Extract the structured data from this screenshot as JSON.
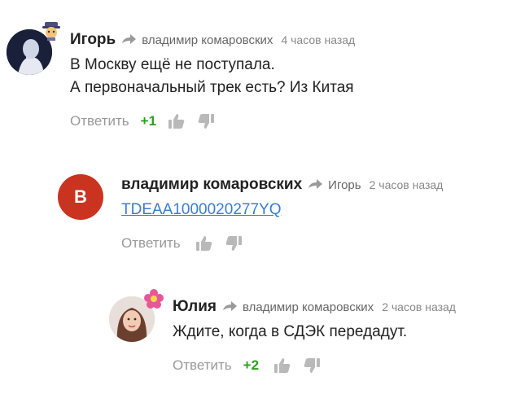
{
  "comments": [
    {
      "author": "Игорь",
      "reply_to": "владимир комаровских",
      "time": "4 часов назад",
      "text_lines": [
        "В Москву ещё не поступала.",
        "А первоначальный трек есть? Из Китая"
      ],
      "reply_label": "Ответить",
      "score": "+1",
      "avatar_icon": "hooded-figure-avatar",
      "badge_icon": "detective-emoji-badge"
    },
    {
      "author": "владимир комаровских",
      "reply_to": "Игорь",
      "time": "2 часов назад",
      "link_text": "TDEAA1000020277YQ",
      "reply_label": "Ответить",
      "score": "",
      "avatar_letter": "В",
      "avatar_color": "#c9331f"
    },
    {
      "author": "Юлия",
      "reply_to": "владимир комаровских",
      "time": "2 часов назад",
      "text_lines": [
        "Ждите, когда в СДЭК передадут."
      ],
      "reply_label": "Ответить",
      "score": "+2",
      "avatar_icon": "woman-portrait-avatar",
      "badge_icon": "flower-emoji-badge"
    }
  ],
  "colors": {
    "score_positive": "#2ca01c",
    "link": "#3a7bd5",
    "muted": "#999999"
  }
}
